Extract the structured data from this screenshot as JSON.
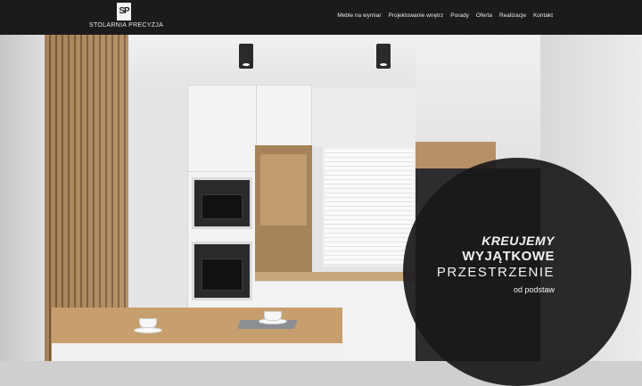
{
  "brand": {
    "logo_mark": "SP",
    "name": "STOLARNIA PRECYZJA"
  },
  "nav": {
    "items": [
      "Meble na wymiar",
      "Projektowanie wnętrz",
      "Porady",
      "Oferta",
      "Realizacje",
      "Kontakt"
    ]
  },
  "hero": {
    "line1": "KREUJEMY",
    "line2": "WYJĄTKOWE",
    "line3": "PRZESTRZENIE",
    "line4": "od podstaw"
  },
  "colors": {
    "topbar": "#1b1b1b",
    "circle": "#19191b",
    "wood": "#b08a5e"
  }
}
